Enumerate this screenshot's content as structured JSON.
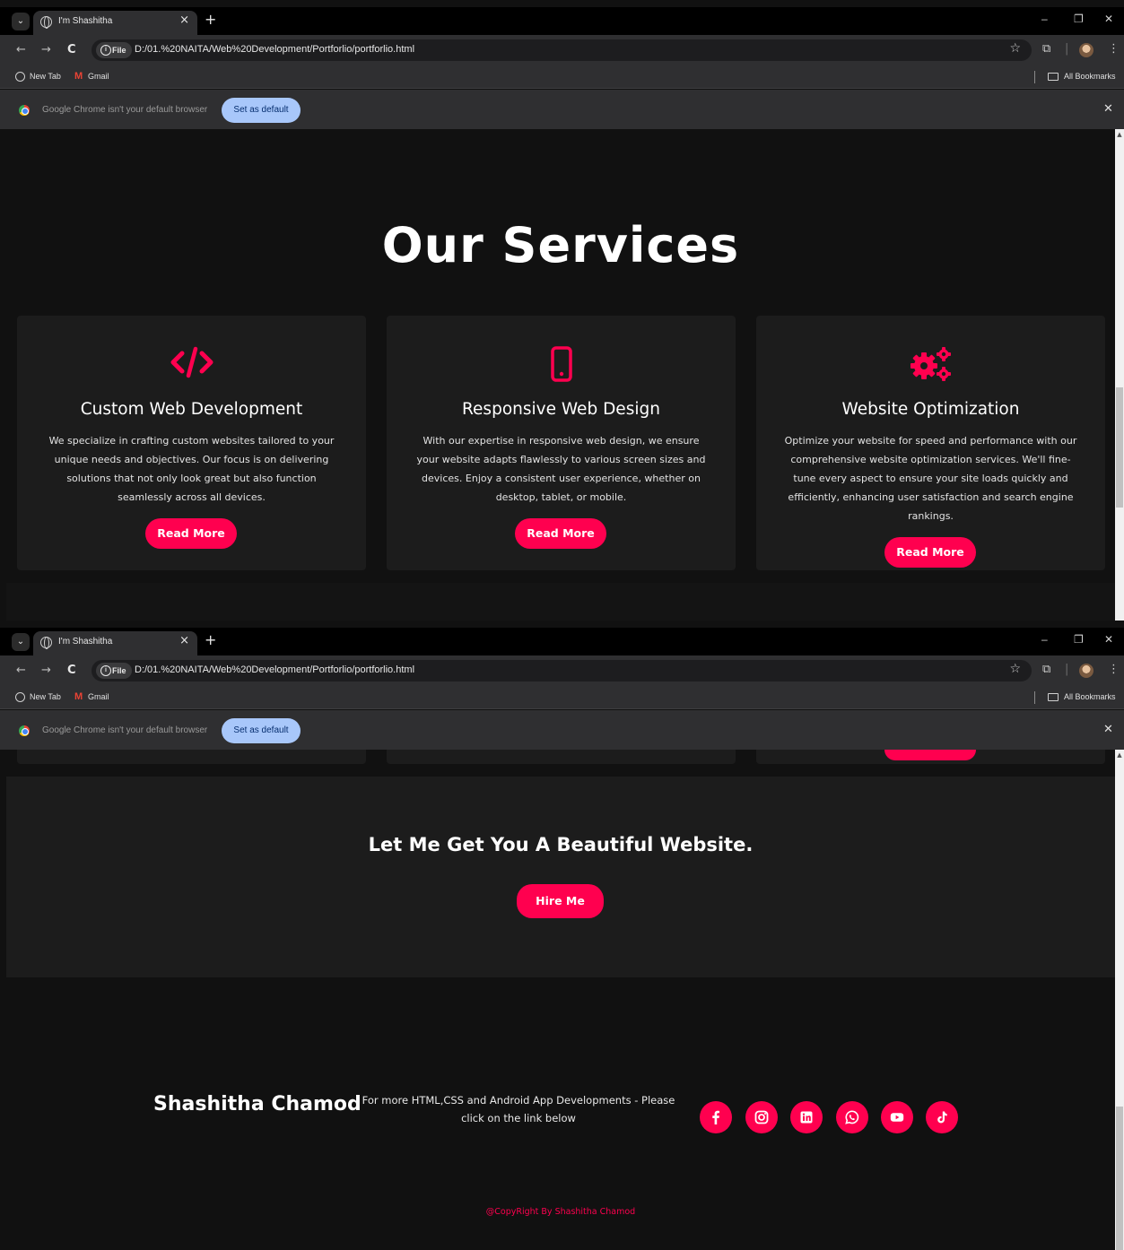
{
  "browser": {
    "tab_title": "I'm Shashitha",
    "tab_close": "×",
    "new_tab": "+",
    "dropdown": "⌄",
    "minimize": "–",
    "restore": "❐",
    "close": "✕",
    "back": "←",
    "forward": "→",
    "reload": "C",
    "chip_label": "File",
    "url": "D:/01.%20NAITA/Web%20Development/Portforlio/portforlio.html",
    "star": "☆",
    "extensions": "⧉",
    "divider": "|",
    "menu": "⋮",
    "bookmarks": {
      "new_tab": "New Tab",
      "gmail_icon": "M",
      "gmail": "Gmail",
      "all": "All Bookmarks"
    },
    "infobar": {
      "text": "Google Chrome isn't your default browser",
      "button": "Set as default",
      "close": "✕"
    },
    "scroll_arrow": "▲"
  },
  "services": {
    "title": "Our Services",
    "cards": [
      {
        "icon": "code-icon",
        "title": "Custom Web Development",
        "text": "We specialize in crafting custom websites tailored to your unique needs and objectives. Our focus is on delivering solutions that not only look great but also function seamlessly across all devices.",
        "button": "Read More"
      },
      {
        "icon": "mobile-icon",
        "title": "Responsive Web Design",
        "text": "With our expertise in responsive web design, we ensure your website adapts flawlessly to various screen sizes and devices. Enjoy a consistent user experience, whether on desktop, tablet, or mobile.",
        "button": "Read More"
      },
      {
        "icon": "gears-icon",
        "title": "Website Optimization",
        "text": "Optimize your website for speed and performance with our comprehensive website optimization services. We'll fine-tune every aspect to ensure your site loads quickly and efficiently, enhancing user satisfaction and search engine rankings.",
        "button": "Read More"
      }
    ]
  },
  "cta": {
    "title": "Let Me Get You A Beautiful Website.",
    "button": "Hire Me"
  },
  "footer": {
    "name": "Shashitha Chamod",
    "note": "For more HTML,CSS and Android App Developments - Please click on the link below",
    "socials": [
      "facebook-icon",
      "instagram-icon",
      "linkedin-icon",
      "whatsapp-icon",
      "youtube-icon",
      "tiktok-icon"
    ],
    "copyright": "@CopyRight By Shashitha Chamod"
  },
  "colors": {
    "accent": "#ff004f",
    "background": "#111111",
    "card": "#1c1c1c",
    "chrome_bar": "#2f2f31"
  }
}
